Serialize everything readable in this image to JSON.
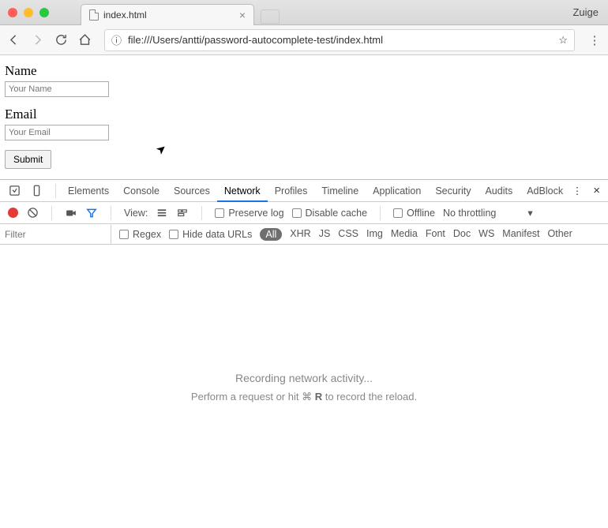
{
  "browser": {
    "tab_title": "index.html",
    "profile": "Zuige",
    "url": "file:///Users/antti/password-autocomplete-test/index.html"
  },
  "form": {
    "name_label": "Name",
    "name_placeholder": "Your Name",
    "email_label": "Email",
    "email_placeholder": "Your Email",
    "submit_label": "Submit"
  },
  "devtools": {
    "tabs": [
      "Elements",
      "Console",
      "Sources",
      "Network",
      "Profiles",
      "Timeline",
      "Application",
      "Security",
      "Audits",
      "AdBlock"
    ],
    "active_tab": 3,
    "row2": {
      "view_label": "View:",
      "preserve": "Preserve log",
      "disable": "Disable cache",
      "offline": "Offline",
      "throttle": "No throttling"
    },
    "filter_placeholder": "Filter",
    "row3": {
      "regex": "Regex",
      "hide": "Hide data URLs"
    },
    "filter_types": [
      "All",
      "XHR",
      "JS",
      "CSS",
      "Img",
      "Media",
      "Font",
      "Doc",
      "WS",
      "Manifest",
      "Other"
    ],
    "msg1": "Recording network activity...",
    "msg2_pre": "Perform a request or hit ⌘ ",
    "msg2_key": "R",
    "msg2_post": " to record the reload."
  }
}
